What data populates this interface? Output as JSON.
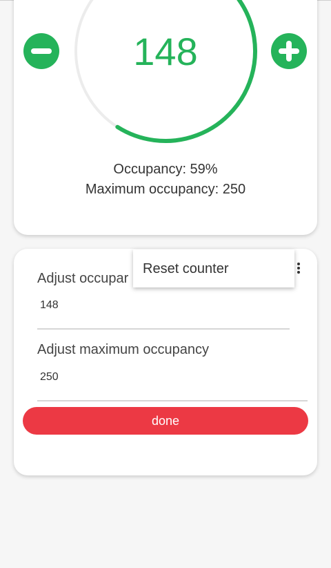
{
  "counter": {
    "value": "148",
    "progress_fraction": 0.59,
    "occupancy_text": "Occupancy: 59%",
    "max_occupancy_text": "Maximum occupancy: 250"
  },
  "adjust": {
    "occupancy_label": "Adjust occupar",
    "occupancy_value": "148",
    "max_label": "Adjust maximum occupancy",
    "max_value": "250",
    "done_label": "done"
  },
  "menu": {
    "items": [
      {
        "label": "Reset counter"
      }
    ]
  },
  "colors": {
    "accent": "#25b35a",
    "danger": "#ec3944",
    "track": "#ececec"
  },
  "icons": {
    "minus": "minus-circle-icon",
    "plus": "plus-circle-icon",
    "overflow": "more-vertical-icon"
  }
}
